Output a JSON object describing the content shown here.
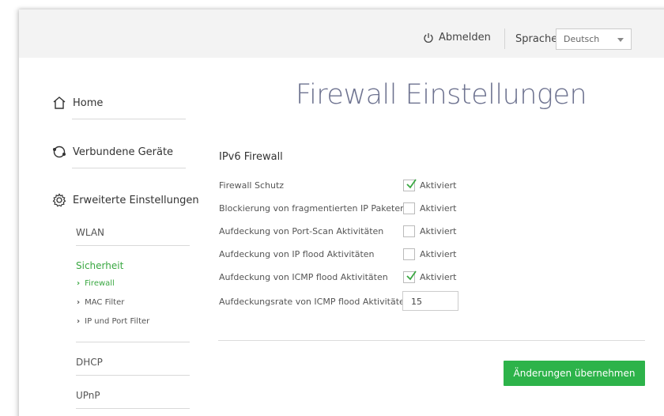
{
  "header": {
    "logout_label": "Abmelden",
    "language_label": "Sprache",
    "language_value": "Deutsch"
  },
  "sidebar": {
    "home_label": "Home",
    "devices_label": "Verbundene Geräte",
    "advanced_label": "Erweiterte Einstellungen",
    "sub_items": {
      "wlan": "WLAN",
      "security": "Sicherheit",
      "dhcp": "DHCP",
      "upnp": "UPnP"
    },
    "security_items": {
      "firewall": "Firewall",
      "mac_filter": "MAC Filter",
      "ip_port_filter": "IP und Port Filter"
    }
  },
  "main": {
    "page_title": "Firewall Einstellungen",
    "section_title": "IPv6 Firewall",
    "rows": [
      {
        "label": "Firewall Schutz",
        "checked": true,
        "state_label": "Aktiviert"
      },
      {
        "label": "Blockierung von fragmentierten IP Paketen",
        "checked": false,
        "state_label": "Aktiviert"
      },
      {
        "label": "Aufdeckung von Port-Scan Aktivitäten",
        "checked": false,
        "state_label": "Aktiviert"
      },
      {
        "label": "Aufdeckung von IP flood Aktivitäten",
        "checked": false,
        "state_label": "Aktiviert"
      },
      {
        "label": "Aufdeckung von ICMP flood Aktivitäten",
        "checked": true,
        "state_label": "Aktiviert"
      }
    ],
    "rate_label": "Aufdeckungsrate von ICMP flood Aktivitäten",
    "rate_value": "15",
    "apply_label": "Änderungen übernehmen"
  },
  "colors": {
    "accent_green": "#3aa842",
    "button_green": "#2db34a",
    "title_color": "#6e7390",
    "header_bg": "#f3f3f3"
  }
}
